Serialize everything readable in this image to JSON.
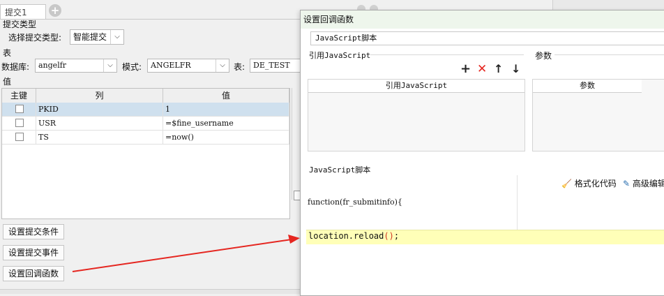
{
  "tabs": {
    "active_label": "提交1",
    "add_symbol": "+"
  },
  "submit_type": {
    "section_label": "提交类型",
    "field_label": "选择提交类型:",
    "value": "智能提交"
  },
  "table_section": {
    "section_label": "表"
  },
  "database": {
    "label": "数据库:",
    "value": "angelfr",
    "mode_label": "模式:",
    "mode_value": "ANGELFR",
    "table_label": "表:",
    "table_value": "DE_TEST"
  },
  "values_section": {
    "section_label": "值"
  },
  "grid": {
    "headers": [
      "主键",
      "列",
      "值"
    ],
    "rows": [
      {
        "column": "PKID",
        "value": "1"
      },
      {
        "column": "USR",
        "value": "=$fine_username"
      },
      {
        "column": "TS",
        "value": "=now()"
      }
    ]
  },
  "buttons": {
    "conditions": "设置提交条件",
    "events": "设置提交事件",
    "callback": "设置回调函数"
  },
  "dialog": {
    "title": "设置回调函数",
    "type_value": "JavaScript脚本",
    "ref_section": "引用JavaScript",
    "param_section": "参数",
    "ref_column": "引用JavaScript",
    "param_column": "参数",
    "script_label": "JavaScript脚本",
    "format_label": "格式化代码",
    "advanced_label": "高级编辑",
    "code_line1": "function(fr_submitinfo){",
    "code_line2_text": "location.reload",
    "code_line2_parens": "()",
    "code_line2_end": ";"
  },
  "colors": {
    "highlight": "#ffffb8",
    "arrow": "#e52620",
    "selected_row": "#cfe0ee"
  }
}
